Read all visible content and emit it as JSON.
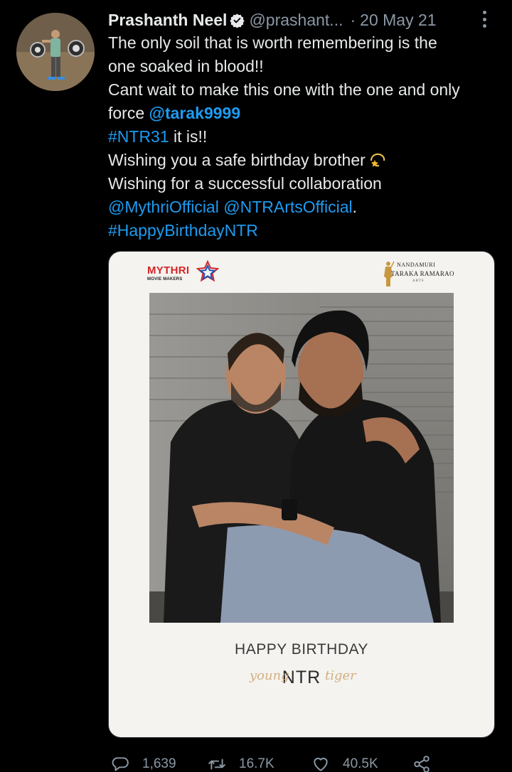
{
  "author": {
    "name": "Prashanth Neel",
    "handle": "@prashant...",
    "separator": "·",
    "date": "20 May 21",
    "verified_icon": "verified-badge-icon",
    "more_icon": "more-vertical-icon"
  },
  "tweet": {
    "line1": "The only soil that is worth remembering is the",
    "line2": "one soaked in blood!!",
    "line3": "Cant wait to make this one with the one and only",
    "line4_prefix": "force ",
    "line4_mention": "@tarak9999",
    "line5_hashtag": "#NTR31",
    "line5_suffix": " it is!!",
    "line6": "Wishing you a safe birthday brother",
    "line6_emoji": "dizzy-emoji",
    "line7": "Wishing for a successful collaboration",
    "line8_mention1": "@MythriOfficial",
    "line8_space": " ",
    "line8_mention2": "@NTRArtsOfficial",
    "line8_suffix": ".",
    "line9_hashtag": "#HappyBirthdayNTR"
  },
  "media": {
    "logo_left_name": "MYTHRI",
    "logo_left_sub": "MOVIE MAKERS",
    "logo_right_line1": "NANDAMURI",
    "logo_right_line2": "TARAKA RAMARAO",
    "logo_right_line3": "ARTS",
    "caption_line1": "HAPPY BIRTHDAY",
    "caption_line2": "NTR",
    "script_left": "young",
    "script_right": "tiger"
  },
  "actions": {
    "reply_count": "1,639",
    "retweet_count": "16.7K",
    "like_count": "40.5K",
    "reply_icon": "reply-icon",
    "retweet_icon": "retweet-icon",
    "like_icon": "heart-icon",
    "share_icon": "share-icon"
  },
  "colors": {
    "background": "#000000",
    "text": "#e7e9ea",
    "secondary": "#8b98a5",
    "link": "#1d9bf0"
  }
}
